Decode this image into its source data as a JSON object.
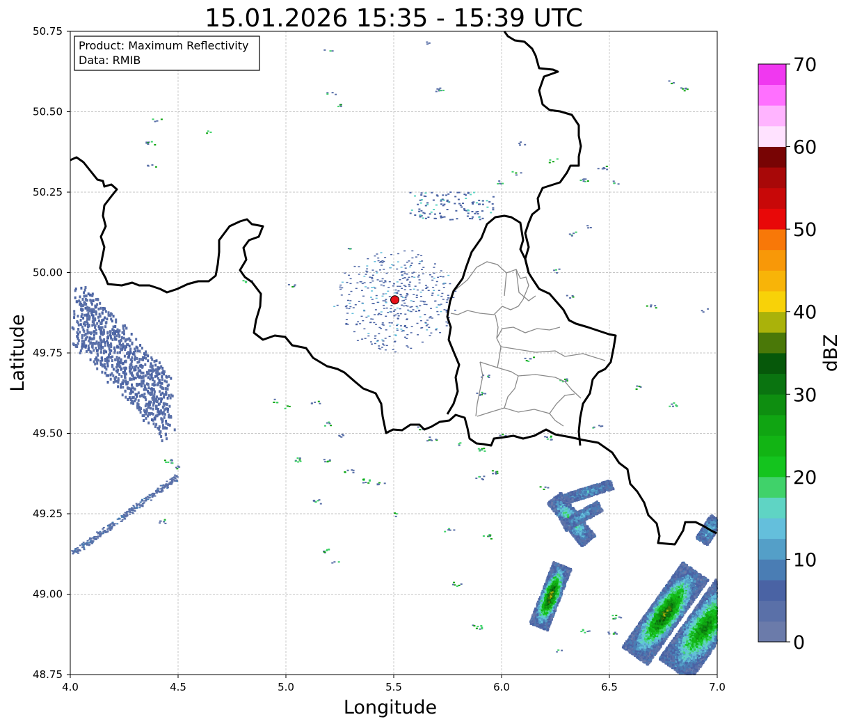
{
  "title": "15.01.2026 15:35 - 15:39 UTC",
  "info": {
    "product_line": "Product: Maximum Reflectivity",
    "data_line": "Data: RMIB"
  },
  "axes": {
    "xlabel": "Longitude",
    "ylabel": "Latitude",
    "xlim": [
      4.0,
      7.0
    ],
    "ylim": [
      48.75,
      50.75
    ],
    "x_ticks": [
      "4.0",
      "4.5",
      "5.0",
      "5.5",
      "6.0",
      "6.5",
      "7.0"
    ],
    "y_ticks": [
      "48.75",
      "49.00",
      "49.25",
      "49.50",
      "49.75",
      "50.00",
      "50.25",
      "50.50",
      "50.75"
    ],
    "grid": true
  },
  "radar_site": {
    "lon": 5.505,
    "lat": 49.915,
    "color": "#e8101a"
  },
  "colorbar": {
    "label": "dBZ",
    "range": [
      0,
      70
    ],
    "ticks": [
      "0",
      "10",
      "20",
      "30",
      "40",
      "50",
      "60",
      "70"
    ],
    "step": 2.5,
    "colors": [
      "#6b7baa",
      "#5a70a8",
      "#4a63a4",
      "#4a7db4",
      "#549fc8",
      "#64bfdc",
      "#5fd4c4",
      "#40d26a",
      "#14c41e",
      "#12b414",
      "#10a512",
      "#0e8e10",
      "#0a7410",
      "#06580a",
      "#4a7808",
      "#aab20a",
      "#f8d208",
      "#f8b408",
      "#f89808",
      "#f87808",
      "#e80808",
      "#c80808",
      "#a80808",
      "#780404",
      "#ffe2ff",
      "#ffb4ff",
      "#ff70ff",
      "#f038f0"
    ]
  }
}
